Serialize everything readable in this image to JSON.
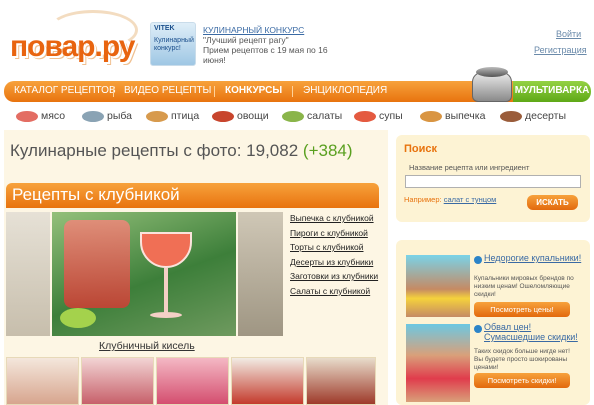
{
  "header": {
    "logo_text": "повар.ру",
    "promo": {
      "brand": "VITEK",
      "badge": "Кулинарный конкурс!",
      "title": "Кулинарный конкурс",
      "subtitle": "\"Лучший рецепт рагу\"",
      "dates": "Прием рецептов с 19 мая по 16 июня!"
    },
    "login_label": "Войти",
    "register_label": "Регистрация"
  },
  "nav": {
    "items": [
      "Каталог рецептов",
      "Видео рецепты",
      "Конкурсы",
      "Энциклопедия"
    ],
    "active_index": 2,
    "multi_label": "Мультиварка"
  },
  "categories": [
    {
      "label": "мясо",
      "icon": "meat-icon",
      "color": "#e36d63"
    },
    {
      "label": "рыба",
      "icon": "fish-icon",
      "color": "#8aa3b4"
    },
    {
      "label": "птица",
      "icon": "poultry-icon",
      "color": "#d79a4d"
    },
    {
      "label": "овощи",
      "icon": "vegetables-icon",
      "color": "#c8452d"
    },
    {
      "label": "салаты",
      "icon": "salad-icon",
      "color": "#8ab54a"
    },
    {
      "label": "супы",
      "icon": "soup-icon",
      "color": "#e45a40"
    },
    {
      "label": "выпечка",
      "icon": "pastry-icon",
      "color": "#d99542"
    },
    {
      "label": "десерты",
      "icon": "dessert-icon",
      "color": "#9a5c3a"
    }
  ],
  "main": {
    "counter_label": "Кулинарные рецепты с фото:",
    "counter_value": "19,082",
    "counter_delta": "(+384)",
    "section_title": "Рецепты с клубникой",
    "featured_caption": "Клубничный кисель",
    "related_links": [
      "Выпечка с клубникой",
      "Пироги с клубникой",
      "Торты с клубникой",
      "Десерты из клубники",
      "Заготовки из клубники",
      "Салаты с клубникой"
    ]
  },
  "search": {
    "title": "Поиск",
    "hint": "Название рецепта или ингредиент",
    "value": "",
    "example_label": "Например:",
    "example_link": "салат с тунцом",
    "button_label": "Искать"
  },
  "ads": [
    {
      "title": "Недорогие купальники!",
      "text": "Купальники мировых брендов по низким ценам! Ошеломляющие скидки!",
      "button": "Посмотреть цены!"
    },
    {
      "title": "Обвал цен! Сумасшедшие скидки!",
      "text": "Таких скидок больше нигде нет! Вы будете просто шокированы ценами!",
      "button": "Посмотреть скидки!"
    }
  ],
  "colors": {
    "accent": "#e8730e",
    "green": "#5ea817",
    "link": "#3a6aa4"
  }
}
